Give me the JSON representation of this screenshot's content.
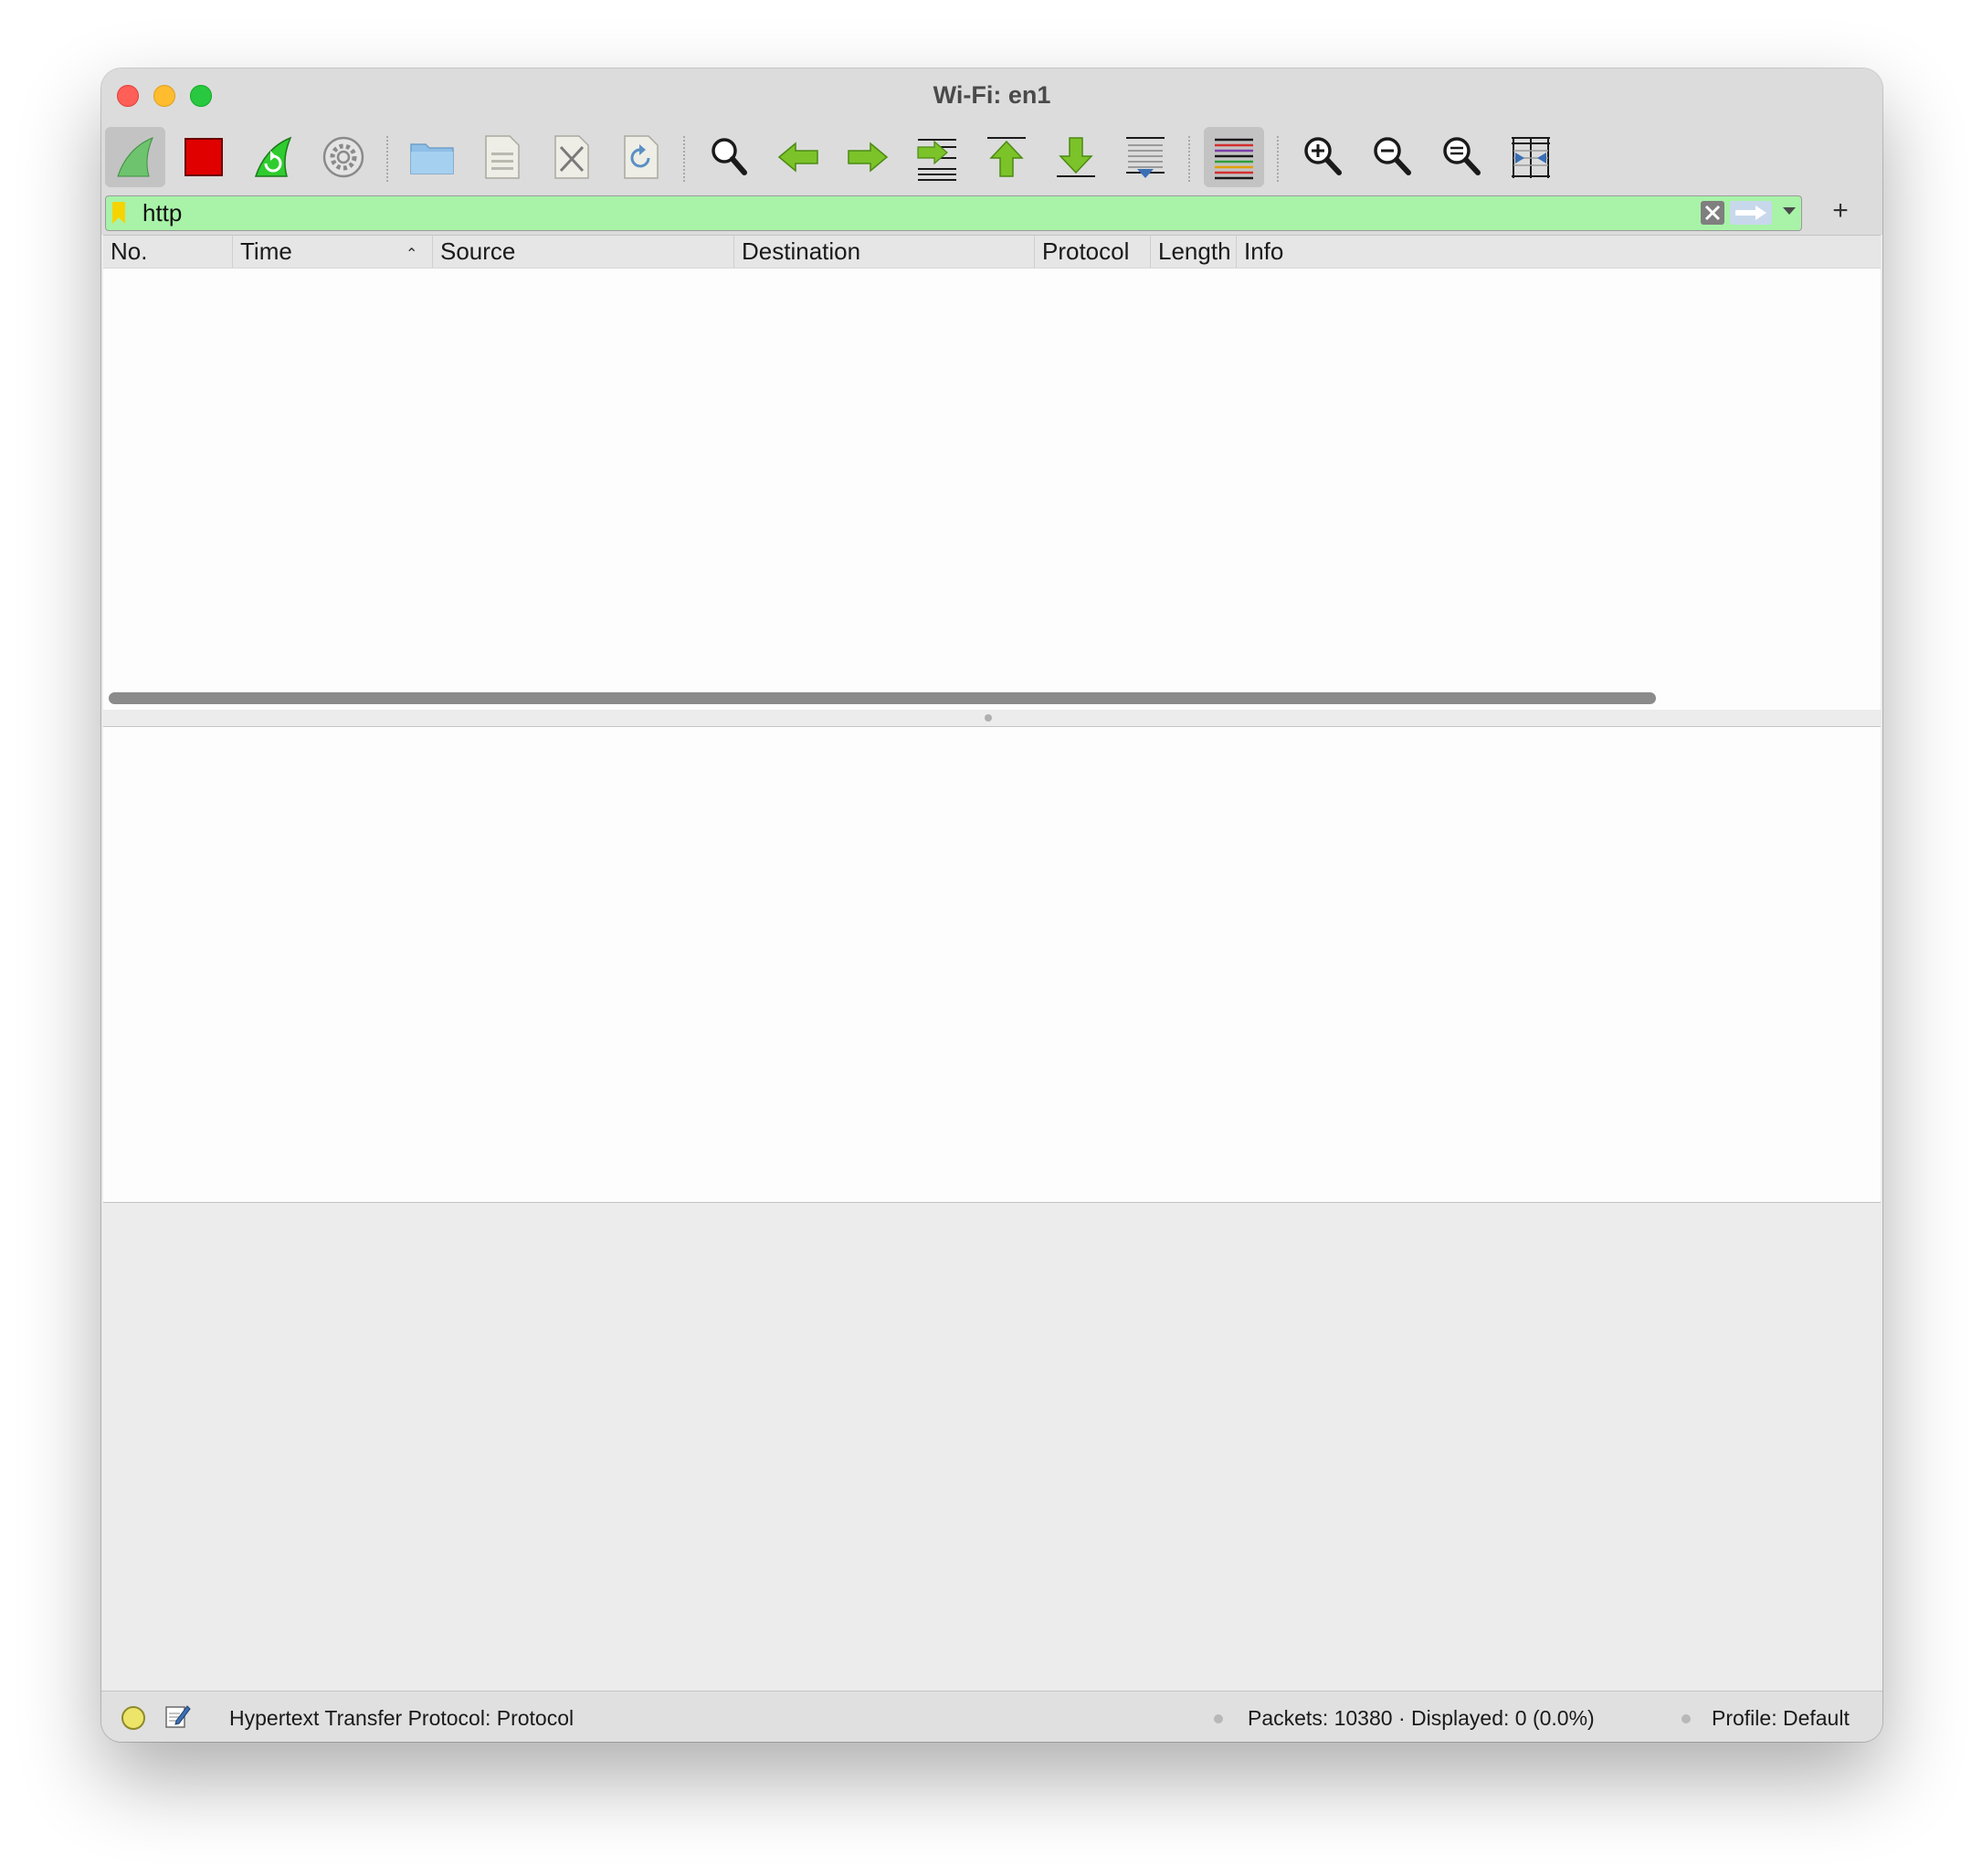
{
  "window": {
    "title": "Wi-Fi: en1"
  },
  "toolbar": {
    "buttons": [
      {
        "name": "start-capture",
        "icon": "shark-fin-icon"
      },
      {
        "name": "stop-capture",
        "icon": "stop-square-icon"
      },
      {
        "name": "restart-capture",
        "icon": "restart-fin-icon"
      },
      {
        "name": "capture-options",
        "icon": "gear-icon"
      },
      {
        "name": "open-file",
        "icon": "folder-icon"
      },
      {
        "name": "save-file",
        "icon": "document-icon"
      },
      {
        "name": "close-file",
        "icon": "close-file-icon"
      },
      {
        "name": "reload-file",
        "icon": "reload-icon"
      },
      {
        "name": "find-packet",
        "icon": "magnifier-icon"
      },
      {
        "name": "go-back",
        "icon": "arrow-left-icon"
      },
      {
        "name": "go-forward",
        "icon": "arrow-right-icon"
      },
      {
        "name": "go-to-packet",
        "icon": "jump-to-packet-icon"
      },
      {
        "name": "go-first",
        "icon": "arrow-up-first-icon"
      },
      {
        "name": "go-last",
        "icon": "arrow-down-last-icon"
      },
      {
        "name": "auto-scroll",
        "icon": "autoscroll-icon"
      },
      {
        "name": "colorize",
        "icon": "colorize-lines-icon"
      },
      {
        "name": "zoom-in",
        "icon": "zoom-in-icon"
      },
      {
        "name": "zoom-out",
        "icon": "zoom-out-icon"
      },
      {
        "name": "zoom-normal",
        "icon": "zoom-normal-icon"
      },
      {
        "name": "resize-columns",
        "icon": "resize-columns-icon"
      }
    ]
  },
  "filter": {
    "value": "http",
    "background": "#a8f3a8",
    "bookmark_icon": "bookmark-icon",
    "clear_icon": "clear-x-icon",
    "apply_icon": "apply-arrow-icon",
    "dropdown_icon": "chevron-down-icon",
    "add_label": "+"
  },
  "packet_list": {
    "columns": [
      "No.",
      "Time",
      "Source",
      "Destination",
      "Protocol",
      "Length",
      "Info"
    ],
    "sort_indicator": "⌃",
    "rows": []
  },
  "status": {
    "expert_icon": "expert-info-led-icon",
    "comment_icon": "comment-edit-icon",
    "field_text": "Hypertext Transfer Protocol: Protocol",
    "packets_text": "Packets: 10380 · Displayed: 0 (0.0%)",
    "profile_text": "Profile: Default"
  },
  "colors": {
    "close": "#fe5f57",
    "minimize": "#febc2e",
    "maximize": "#28c840",
    "filter_valid": "#a8f3a8",
    "stop_red": "#e00000"
  }
}
